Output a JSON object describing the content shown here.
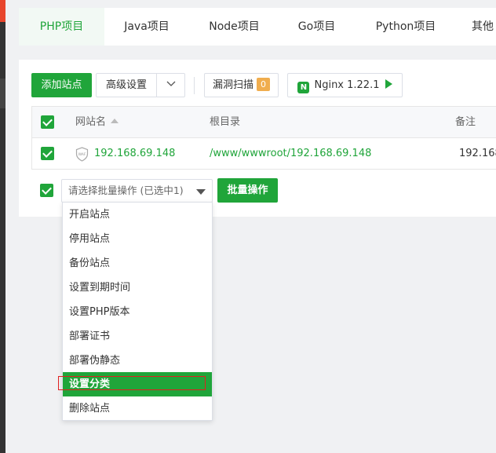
{
  "tabs": [
    {
      "label": "PHP项目",
      "active": true
    },
    {
      "label": "Java项目",
      "active": false
    },
    {
      "label": "Node项目",
      "active": false
    },
    {
      "label": "Go项目",
      "active": false
    },
    {
      "label": "Python项目",
      "active": false
    },
    {
      "label": "其他",
      "active": false
    }
  ],
  "toolbar": {
    "add_site": "添加站点",
    "advanced": "高级设置",
    "vuln_scan": "漏洞扫描",
    "vuln_count": "0",
    "nginx": "Nginx 1.22.1"
  },
  "table": {
    "headers": {
      "name": "网站名",
      "root": "根目录",
      "note": "备注"
    },
    "rows": [
      {
        "name": "192.168.69.148",
        "root": "/www/wwwroot/192.168.69.148",
        "note": "192.168"
      }
    ]
  },
  "batch": {
    "placeholder": "请选择批量操作 (已选中1)",
    "button": "批量操作",
    "menu": [
      "开启站点",
      "停用站点",
      "备份站点",
      "设置到期时间",
      "设置PHP版本",
      "部署证书",
      "部署伪静态",
      "设置分类",
      "删除站点"
    ],
    "active_index": 7
  },
  "colors": {
    "accent": "#20a53a",
    "badge": "#f0ad4e",
    "highlight_box": "#e02020"
  }
}
